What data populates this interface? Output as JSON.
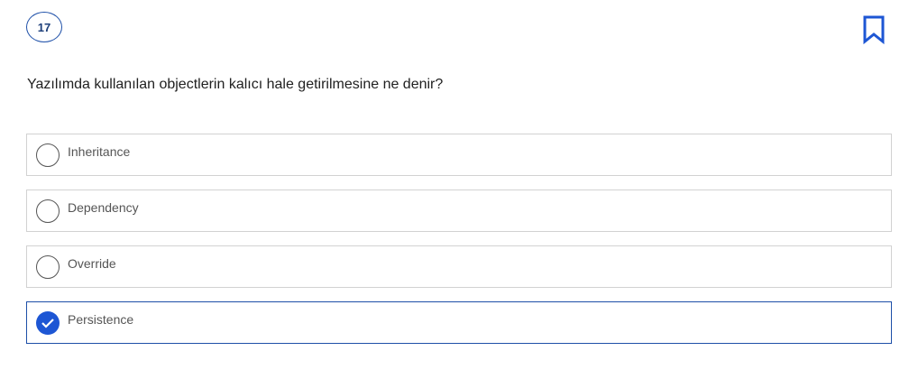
{
  "question": {
    "number": "17",
    "text": "Yazılımda kullanılan objectlerin kalıcı hale getirilmesine ne denir?"
  },
  "options": [
    {
      "label": "Inheritance",
      "selected": false
    },
    {
      "label": "Dependency",
      "selected": false
    },
    {
      "label": "Override",
      "selected": false
    },
    {
      "label": "Persistence",
      "selected": true
    }
  ],
  "colors": {
    "accent": "#1d56d4",
    "border": "#d2d2d2",
    "selected_border": "#1d4fa8"
  },
  "icons": {
    "bookmark": "bookmark-icon",
    "check": "check-icon"
  }
}
